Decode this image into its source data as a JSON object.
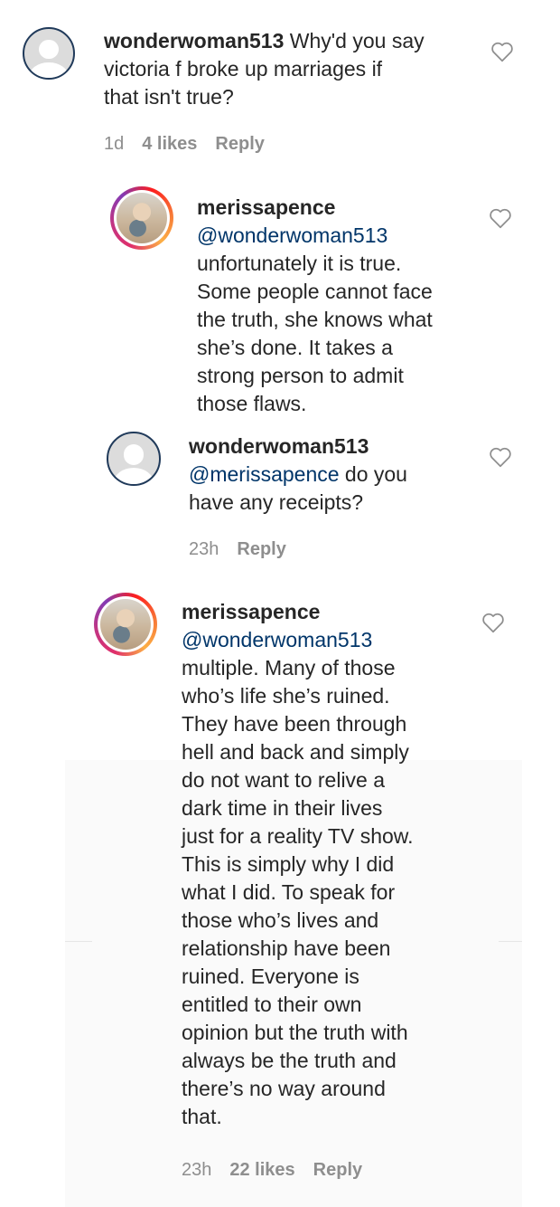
{
  "comments": [
    {
      "username": "wonderwoman513",
      "mention": "",
      "body": "Why'd you say\nvictoria f broke up marriages if\nthat isn't true?",
      "time": "1d",
      "likes": "4 likes",
      "reply": "Reply"
    },
    {
      "username": "merissapence",
      "mention": "@wonderwoman513",
      "body": "unfortunately it is true.\nSome people cannot face\nthe truth, she knows what\nshe’s done. It takes a\nstrong person to admit\nthose flaws.",
      "time": "",
      "likes": "",
      "reply": ""
    },
    {
      "username": "wonderwoman513",
      "mention": "@merissapence",
      "body": "do you\nhave any receipts?",
      "time": "23h",
      "likes": "",
      "reply": "Reply"
    },
    {
      "username": "merissapence",
      "mention": "@wonderwoman513",
      "body": "multiple. Many of those\nwho’s life she’s ruined.\nThey have been through\nhell and back and simply\ndo not want to relive a\ndark time in their lives\njust for a reality TV show.\nThis is simply why I did\nwhat I did. To speak for\nthose who’s lives and\nrelationship have been\nruined. Everyone is\nentitled to their own\nopinion but the truth with\nalways be the truth and\nthere’s no way around\nthat.",
      "time": "23h",
      "likes": "22 likes",
      "reply": "Reply"
    }
  ],
  "icons": {
    "like": "heart-outline-icon",
    "avatar_default": "default-avatar-icon"
  },
  "colors": {
    "text": "#262626",
    "mention": "#003569",
    "meta": "#8e8e8e"
  }
}
